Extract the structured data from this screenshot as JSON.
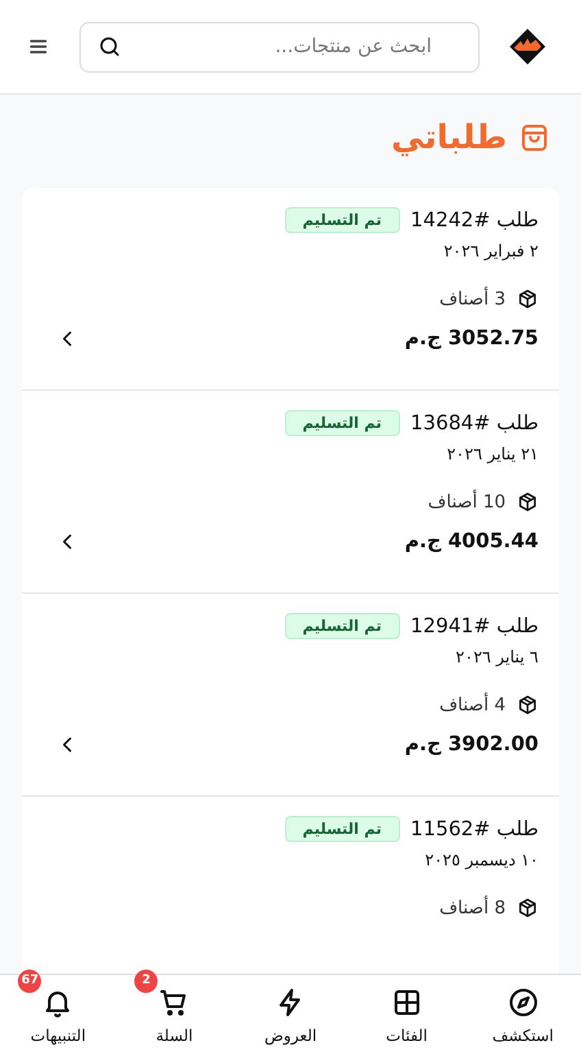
{
  "header": {
    "search": {
      "placeholder": "ابحث عن منتجات..."
    }
  },
  "page_title": "طلباتي",
  "orders": [
    {
      "title": "طلب #14242",
      "status": "تم التسليم",
      "date": "٢ فبراير ٢٠٢٦",
      "items": "3 أصناف",
      "total": "3052.75 ج.م"
    },
    {
      "title": "طلب #13684",
      "status": "تم التسليم",
      "date": "٢١ يناير ٢٠٢٦",
      "items": "10 أصناف",
      "total": "4005.44 ج.م"
    },
    {
      "title": "طلب #12941",
      "status": "تم التسليم",
      "date": "٦ يناير ٢٠٢٦",
      "items": "4 أصناف",
      "total": "3902.00 ج.م"
    },
    {
      "title": "طلب #11562",
      "status": "تم التسليم",
      "date": "١٠ ديسمبر ٢٠٢٥",
      "items": "8 أصناف"
    }
  ],
  "bottom_nav": [
    {
      "label": "استكشف"
    },
    {
      "label": "الفئات"
    },
    {
      "label": "العروض"
    },
    {
      "label": "السلة",
      "badge": "2"
    },
    {
      "label": "التنبيهات",
      "badge": "67"
    }
  ]
}
